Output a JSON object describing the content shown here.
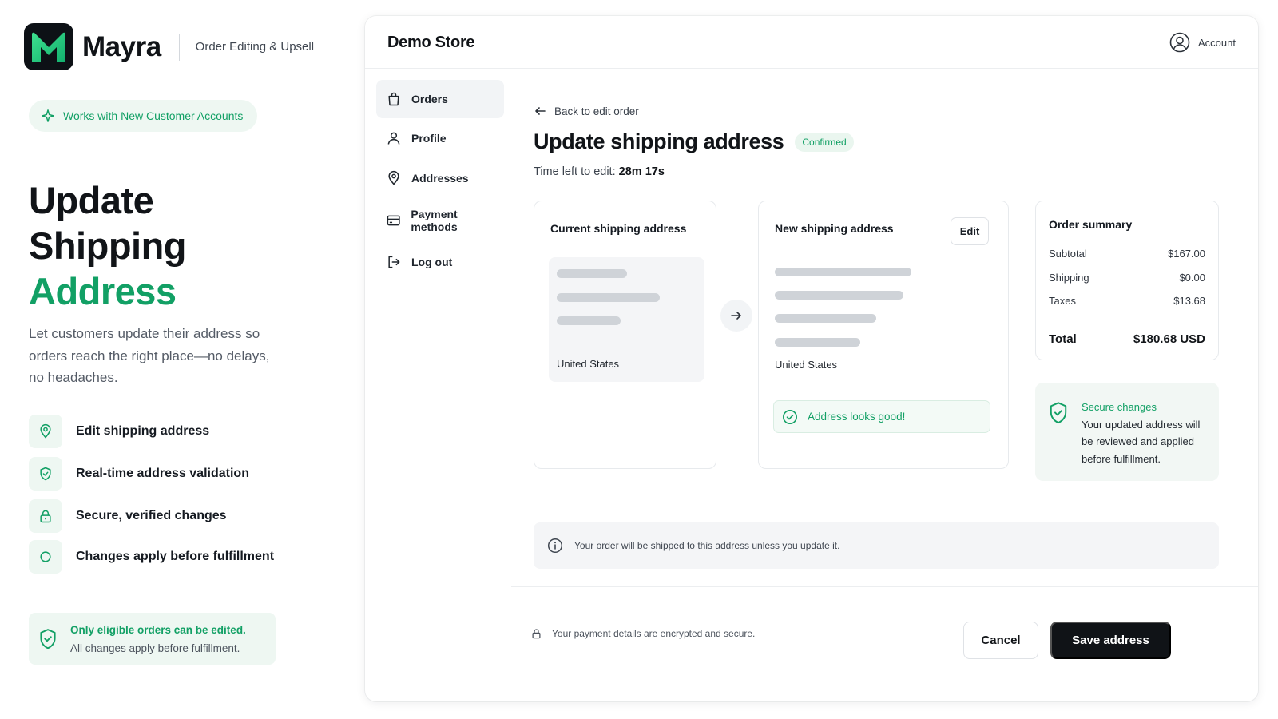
{
  "brand": {
    "name": "Mayra",
    "tagline": "Order Editing & Upsell",
    "logo_letter": "M",
    "accent_color": "#12a065"
  },
  "pill": {
    "label": "Works with New Customer Accounts",
    "icon": "sparkle-icon"
  },
  "hero": {
    "line1": "Update",
    "line2": "Shipping",
    "line3": "Address",
    "description": "Let customers update their address so orders reach the right place—no delays, no headaches."
  },
  "features": [
    {
      "label": "Edit shipping address",
      "icon": "map-pin-icon"
    },
    {
      "label": "Real-time address validation",
      "icon": "shield-check-icon"
    },
    {
      "label": "Secure, verified changes",
      "icon": "lock-icon"
    },
    {
      "label": "Changes apply before fulfillment",
      "icon": "circle-icon"
    }
  ],
  "note": {
    "title": "Only eligible orders can be edited.",
    "body": "All changes apply before fulfillment.",
    "icon": "shield-check-icon"
  },
  "store": {
    "name": "Demo Store",
    "account_label": "Account"
  },
  "sidebar": {
    "items": [
      {
        "label": "Orders",
        "icon": "shopping-bag-icon",
        "active": true
      },
      {
        "label": "Profile",
        "icon": "user-icon",
        "active": false
      },
      {
        "label": "Addresses",
        "icon": "map-pin-icon",
        "active": false
      },
      {
        "label": "Payment methods",
        "icon": "credit-card-icon",
        "active": false
      },
      {
        "label": "Log out",
        "icon": "logout-icon",
        "active": false
      }
    ]
  },
  "main": {
    "back_label": "Back to edit order",
    "title": "Update shipping address",
    "status_badge": "Confirmed",
    "timer_label": "Time left to edit:",
    "timer_value": "28m 17s"
  },
  "current_address": {
    "title": "Current shipping address",
    "country": "United States"
  },
  "new_address": {
    "title": "New shipping address",
    "edit_label": "Edit",
    "country": "United States",
    "validation": "Address looks good!"
  },
  "summary": {
    "title": "Order summary",
    "rows": [
      {
        "label": "Subtotal",
        "value": "$167.00"
      },
      {
        "label": "Shipping",
        "value": "$0.00"
      },
      {
        "label": "Taxes",
        "value": "$13.68"
      }
    ],
    "total_label": "Total",
    "total_value": "$180.68 USD"
  },
  "secure_panel": {
    "title": "Secure changes",
    "body": "Your updated address will be reviewed and applied before fulfillment."
  },
  "info_message": "Your order will be shipped to this address unless you update it.",
  "footer": {
    "encryption_note": "Your payment details are encrypted and secure.",
    "cancel_label": "Cancel",
    "save_label": "Save address"
  }
}
